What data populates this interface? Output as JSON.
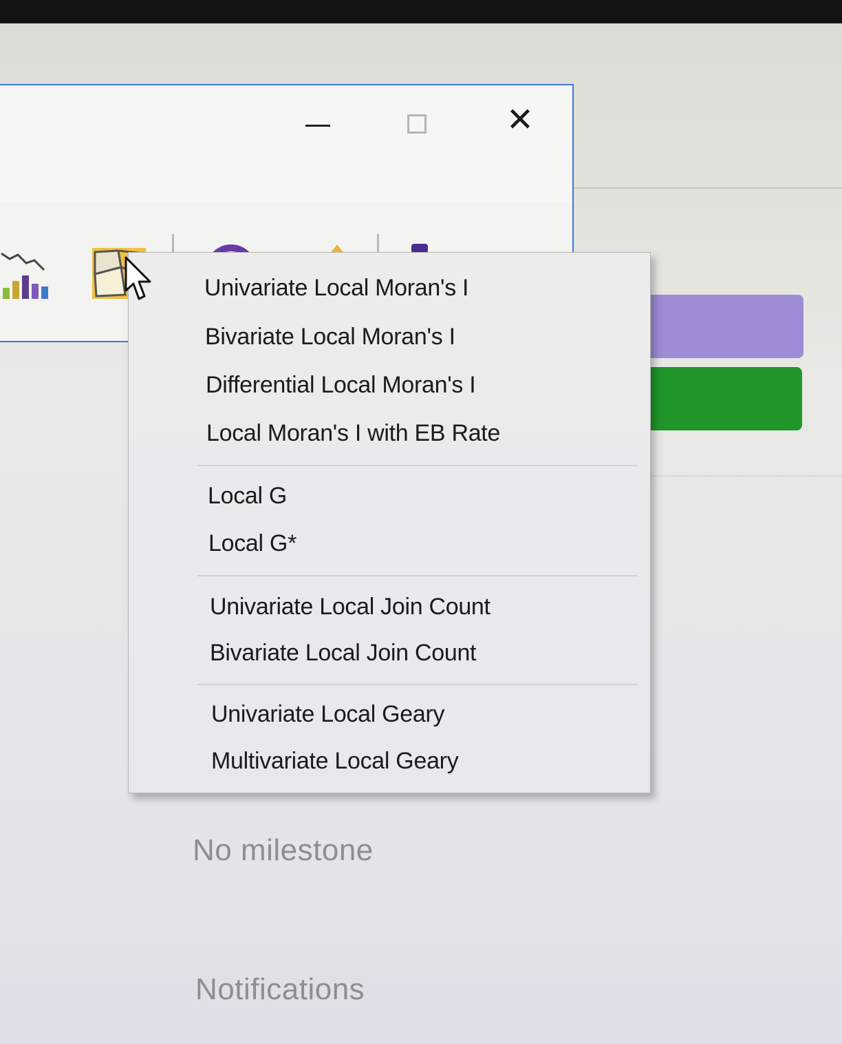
{
  "window": {
    "controls": [
      "minimize",
      "maximize",
      "close"
    ],
    "close_glyph": "✕"
  },
  "toolbar": {
    "icons": [
      "chart-bar-icon",
      "local-autocorrelation-map-icon",
      "donut-chart-icon",
      "spatial-regression-icon",
      "rate-icon"
    ]
  },
  "labels_panel": {
    "colors": [
      "#a08bd6",
      "#20952a"
    ]
  },
  "context_menu": {
    "groups": [
      [
        "Univariate Local Moran's I",
        "Bivariate Local Moran's I",
        "Differential Local Moran's I",
        "Local Moran's I with EB Rate"
      ],
      [
        "Local G",
        "Local G*"
      ],
      [
        "Univariate Local Join Count",
        "Bivariate Local Join Count"
      ],
      [
        "Univariate Local Geary",
        "Multivariate Local Geary"
      ]
    ]
  },
  "sidebar": {
    "milestone": "No milestone",
    "notifications": "Notifications"
  }
}
